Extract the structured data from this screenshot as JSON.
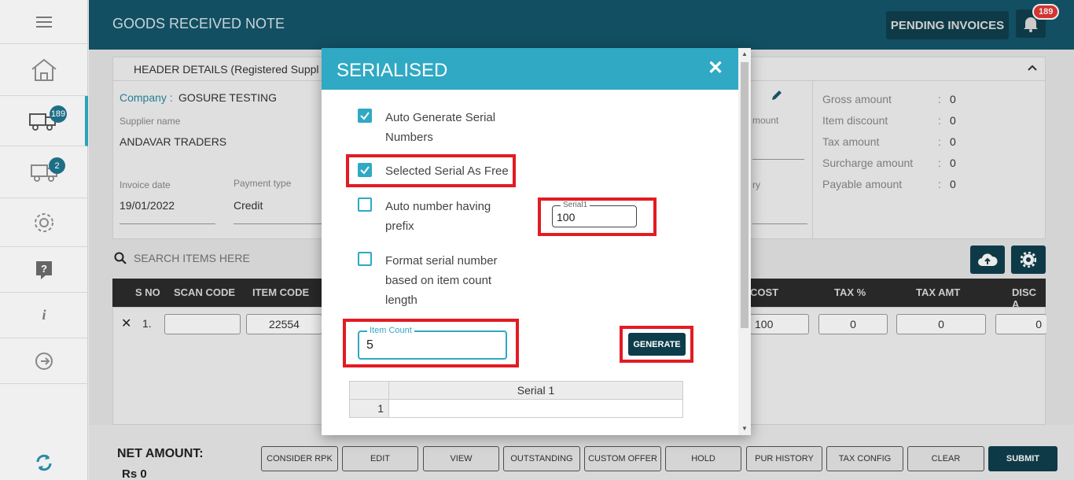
{
  "header": {
    "title": "GOODS RECEIVED NOTE",
    "pending_label": "PENDING INVOICES",
    "notification_count": "189"
  },
  "sidebar": {
    "items": [
      {
        "icon": "menu-icon"
      },
      {
        "icon": "home-icon"
      },
      {
        "icon": "truck-icon",
        "badge": "189"
      },
      {
        "icon": "truck-icon",
        "badge": "2"
      },
      {
        "icon": "gear-icon"
      },
      {
        "icon": "help-icon"
      },
      {
        "icon": "info-icon"
      },
      {
        "icon": "logout-icon"
      },
      {
        "icon": "sync-icon"
      }
    ]
  },
  "panel": {
    "header_text": "HEADER DETAILS (Registered Suppl",
    "company_label": "Company :",
    "company_value": "GOSURE TESTING",
    "supplier_label": "Supplier name",
    "supplier_value": "ANDAVAR TRADERS",
    "invoice_date_label": "Invoice date",
    "invoice_date_value": "19/01/2022",
    "payment_type_label": "Payment type",
    "payment_type_value": "Credit",
    "amount_label_partial": "mount",
    "entry_label_partial": "ry",
    "summary": [
      {
        "label": "Gross amount",
        "value": "0"
      },
      {
        "label": "Item discount",
        "value": "0"
      },
      {
        "label": "Tax amount",
        "value": "0"
      },
      {
        "label": "Surcharge amount",
        "value": "0"
      },
      {
        "label": "Payable amount",
        "value": "0"
      }
    ],
    "colon": ":"
  },
  "search": {
    "placeholder": "SEARCH ITEMS HERE"
  },
  "table": {
    "headers": [
      "S NO",
      "SCAN CODE",
      "ITEM CODE",
      "COST",
      "TAX %",
      "TAX AMT",
      "DISC A"
    ],
    "row": {
      "sno": "1.",
      "scan_code": "",
      "item_code": "22554",
      "cost": "100",
      "tax_pct": "0",
      "tax_amt": "0",
      "disc": "0"
    }
  },
  "footer": {
    "net_amount_label": "NET AMOUNT:",
    "net_amount_value": "Rs 0",
    "buttons": [
      "CONSIDER RPK",
      "EDIT",
      "VIEW",
      "OUTSTANDING",
      "CUSTOM OFFER",
      "HOLD",
      "PUR HISTORY",
      "TAX CONFIG",
      "CLEAR",
      "SUBMIT"
    ]
  },
  "modal": {
    "title": "SERIALISED",
    "close": "✕",
    "options": [
      {
        "label_line1": "Auto Generate Serial",
        "label_line2": "Numbers",
        "checked": true
      },
      {
        "label_line1": "Selected Serial As Free",
        "checked": true
      },
      {
        "label_line1": "Auto number having",
        "label_line2": "prefix",
        "checked": false
      },
      {
        "label_line1": "Format serial number",
        "label_line2": "based on item count",
        "label_line3": "length",
        "checked": false
      }
    ],
    "serial_field": {
      "label": "Serial1",
      "value": "100"
    },
    "item_count_field": {
      "label": "Item Count",
      "value": "5"
    },
    "generate_label": "GENERATE",
    "serial_table": {
      "header": "Serial 1",
      "rows": [
        {
          "index": "1",
          "value": ""
        }
      ]
    }
  },
  "colors": {
    "accent": "#2fa9c4",
    "header_bg": "#14566b",
    "dark_btn": "#103f4e",
    "highlight": "#e31b23"
  }
}
